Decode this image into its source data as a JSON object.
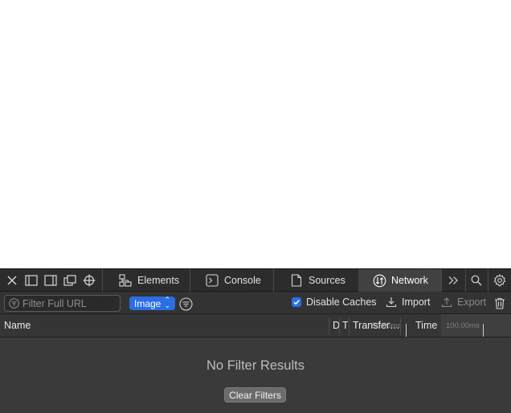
{
  "tabs": [
    {
      "label": "Elements",
      "icon": "elements-icon"
    },
    {
      "label": "Console",
      "icon": "console-icon"
    },
    {
      "label": "Sources",
      "icon": "sources-icon"
    },
    {
      "label": "Network",
      "icon": "network-icon",
      "active": true
    }
  ],
  "filter": {
    "placeholder": "Filter Full URL",
    "type_label": "Image",
    "disable_caches_label": "Disable Caches",
    "disable_caches_checked": true,
    "import_label": "Import",
    "export_label": "Export"
  },
  "columns": {
    "name": "Name",
    "domain": "D",
    "type": "T",
    "transfer": "Transfer…",
    "time": "Time",
    "timeline_50": "50.00ms",
    "timeline_100": "100.00ms"
  },
  "empty_state": {
    "title": "No Filter Results",
    "button": "Clear Filters"
  },
  "colors": {
    "accent": "#2b6ee3",
    "panel": "#3a3a3a",
    "toolbar": "#2c2c2c"
  }
}
